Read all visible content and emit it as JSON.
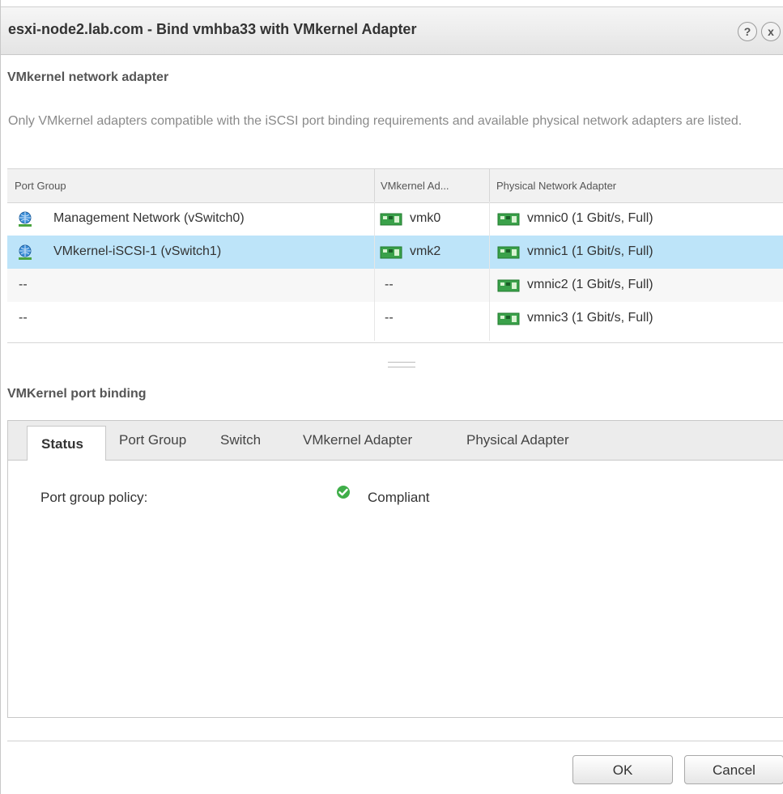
{
  "dialog": {
    "title": "esxi-node2.lab.com - Bind vmhba33 with VMkernel Adapter",
    "help_glyph": "?",
    "close_glyph": "x"
  },
  "adapter_section": {
    "title": "VMkernel network adapter",
    "description": "Only VMkernel adapters compatible with the iSCSI port binding requirements and available physical network adapters are listed."
  },
  "table": {
    "columns": [
      "Port Group",
      "VMkernel Ad...",
      "Physical Network Adapter"
    ],
    "rows": [
      {
        "port_group": "Management Network (vSwitch0)",
        "vmk": "vmk0",
        "pnic": "vmnic0 (1 Gbit/s, Full)",
        "selected": false
      },
      {
        "port_group": "VMkernel-iSCSI-1 (vSwitch1)",
        "vmk": "vmk2",
        "pnic": "vmnic1 (1 Gbit/s, Full)",
        "selected": true
      },
      {
        "port_group": "--",
        "vmk": "--",
        "pnic": "vmnic2 (1 Gbit/s, Full)",
        "selected": false
      },
      {
        "port_group": "--",
        "vmk": "--",
        "pnic": "vmnic3 (1 Gbit/s, Full)",
        "selected": false
      }
    ]
  },
  "binding_section": {
    "title": "VMKernel port binding",
    "tabs": [
      "Status",
      "Port Group",
      "Switch",
      "VMkernel Adapter",
      "Physical Adapter"
    ],
    "active_tab": "Status",
    "status": {
      "label": "Port group policy:",
      "value": "Compliant"
    }
  },
  "buttons": {
    "ok": "OK",
    "cancel": "Cancel"
  },
  "colors": {
    "selected_row": "#bde4f9",
    "compliant_green": "#3fae49"
  }
}
